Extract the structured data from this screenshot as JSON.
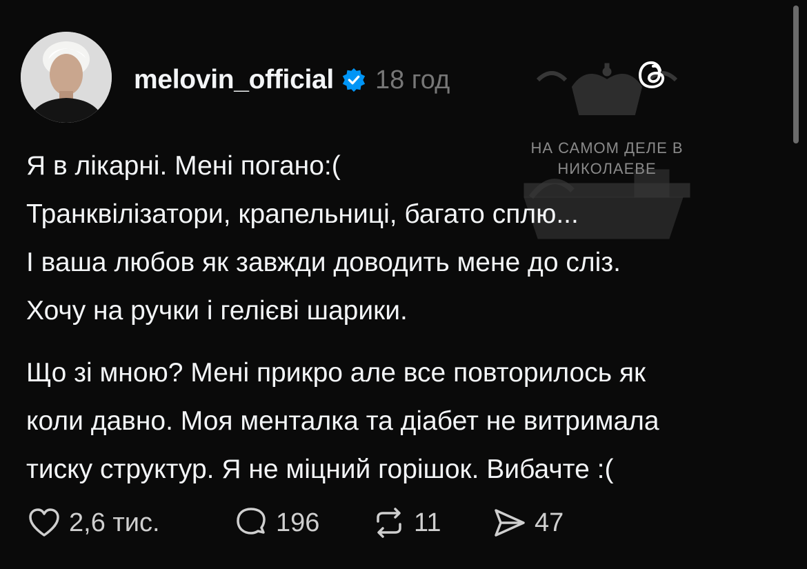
{
  "post": {
    "author": {
      "username": "melovin_official",
      "verified": true,
      "timestamp": "18 год",
      "avatar": "profile-photo"
    },
    "app_icon": "threads-logo-icon",
    "watermark": {
      "lines": [
        "НА САМОМ ДЕЛЕ В",
        "НИКОЛАЕВЕ"
      ]
    },
    "paragraphs": [
      [
        "Я в лікарні. Мені погано:(",
        "Транквілізатори, крапельниці, багато сплю...",
        "І ваша любов як завжди доводить мене до сліз.",
        "Хочу на ручки і гелієві шарики."
      ],
      [
        "Що зі мною? Мені прикро але все повторилось як",
        "коли давно. Моя менталка та діабет не витримала",
        "тиску структур. Я не міцний горішок. Вибачте :("
      ]
    ],
    "actions": {
      "likes": "2,6 тис.",
      "replies": "196",
      "reposts": "11",
      "shares": "47"
    }
  },
  "colors": {
    "background": "#0a0a0a",
    "text": "#f3f5f7",
    "muted": "#777777",
    "verified": "#0095f6"
  }
}
